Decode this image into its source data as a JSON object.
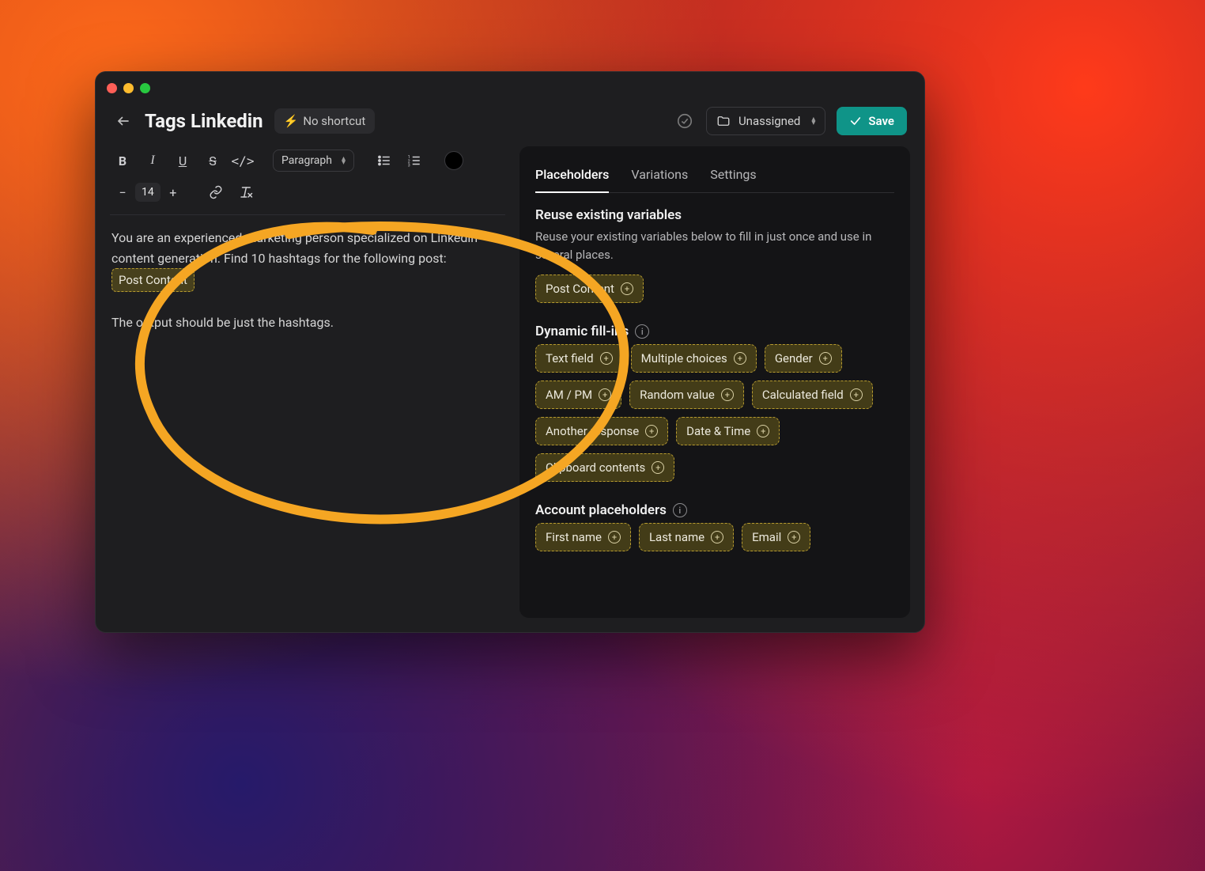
{
  "header": {
    "title": "Tags Linkedin",
    "shortcut_label": "No shortcut",
    "folder_label": "Unassigned",
    "save_label": "Save"
  },
  "toolbar": {
    "paragraph_label": "Paragraph",
    "font_size": "14"
  },
  "editor": {
    "line1": "You are an experienced marketing person specialized on Linkedin content generation. Find 10 hashtags for the following post:",
    "var_chip": "Post Content",
    "line2": "The output should be just the hashtags."
  },
  "side": {
    "tabs": {
      "placeholders": "Placeholders",
      "variations": "Variations",
      "settings": "Settings"
    },
    "reuse": {
      "title": "Reuse existing variables",
      "desc": "Reuse your existing variables below to fill in just once and use in several places.",
      "chips": [
        "Post Content"
      ]
    },
    "dynamic": {
      "title": "Dynamic fill-ins",
      "chips": [
        "Text field",
        "Multiple choices",
        "Gender",
        "AM / PM",
        "Random value",
        "Calculated field",
        "Another response",
        "Date & Time",
        "Clipboard contents"
      ]
    },
    "account": {
      "title": "Account placeholders",
      "chips": [
        "First name",
        "Last name",
        "Email"
      ]
    }
  }
}
